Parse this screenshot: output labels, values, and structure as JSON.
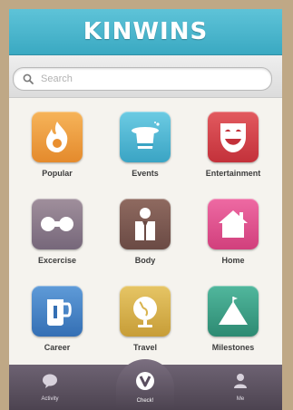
{
  "header": {
    "title": "KINWINS"
  },
  "search": {
    "placeholder": "Search"
  },
  "categories": [
    {
      "label": "Popular",
      "icon": "flame-icon",
      "color": "#ee9a3a"
    },
    {
      "label": "Events",
      "icon": "magic-hat-icon",
      "color": "#4eb6d3"
    },
    {
      "label": "Entertainment",
      "icon": "theater-mask-icon",
      "color": "#d5434a"
    },
    {
      "label": "Excercise",
      "icon": "dumbbell-icon",
      "color": "#8a7b87"
    },
    {
      "label": "Body",
      "icon": "person-suit-icon",
      "color": "#7b5a52"
    },
    {
      "label": "Home",
      "icon": "house-icon",
      "color": "#e2508c"
    },
    {
      "label": "Career",
      "icon": "coffee-mug-icon",
      "color": "#4a86c8"
    },
    {
      "label": "Travel",
      "icon": "globe-icon",
      "color": "#d6b14e"
    },
    {
      "label": "Milestones",
      "icon": "mountain-icon",
      "color": "#3aa088"
    }
  ],
  "tabbar": {
    "activity": "Activity",
    "checkin": "Check!",
    "me": "Me"
  }
}
